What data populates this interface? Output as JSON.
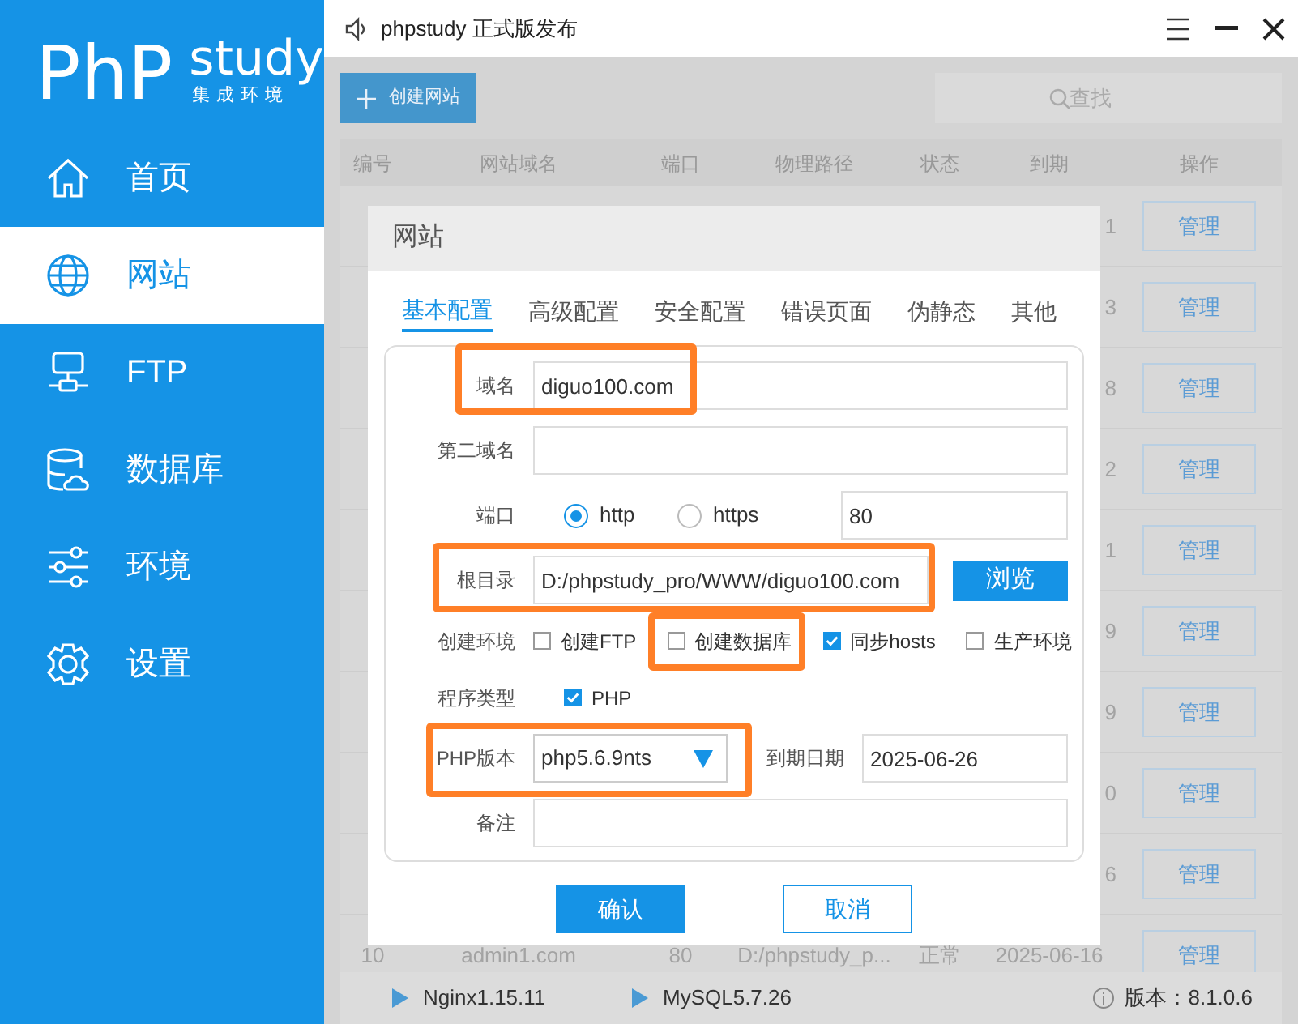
{
  "window": {
    "title": "phpstudy 正式版发布"
  },
  "sidebar": {
    "logo": {
      "main": "PhP",
      "sub": "study",
      "tagline": "集成环境"
    },
    "items": [
      {
        "label": "首页",
        "selected": false
      },
      {
        "label": "网站",
        "selected": true
      },
      {
        "label": "FTP",
        "selected": false
      },
      {
        "label": "数据库",
        "selected": false
      },
      {
        "label": "环境",
        "selected": false
      },
      {
        "label": "设置",
        "selected": false
      }
    ]
  },
  "toolbar": {
    "create_button": "创建网站",
    "search": {
      "placeholder": "查找"
    }
  },
  "table": {
    "columns": [
      "编号",
      "网站域名",
      "端口",
      "物理路径",
      "状态",
      "到期",
      "操作"
    ],
    "rows": [
      {
        "expiry": "1",
        "action": "管理"
      },
      {
        "expiry": "3",
        "action": "管理"
      },
      {
        "expiry": "8",
        "action": "管理"
      },
      {
        "expiry": "2",
        "action": "管理"
      },
      {
        "expiry": "1",
        "action": "管理"
      },
      {
        "expiry": "9",
        "action": "管理"
      },
      {
        "expiry": "9",
        "action": "管理"
      },
      {
        "expiry": "0",
        "action": "管理"
      },
      {
        "expiry": "6",
        "action": "管理"
      },
      {
        "number": "10",
        "domain": "admin1.com",
        "port": "80",
        "path": "D:/phpstudy_p...",
        "status": "正常",
        "expiry": "2025-06-16",
        "action": "管理"
      }
    ]
  },
  "dialog": {
    "title": "网站",
    "tabs": [
      {
        "label": "基本配置",
        "selected": true
      },
      {
        "label": "高级配置",
        "selected": false
      },
      {
        "label": "安全配置",
        "selected": false
      },
      {
        "label": "错误页面",
        "selected": false
      },
      {
        "label": "伪静态",
        "selected": false
      },
      {
        "label": "其他",
        "selected": false
      }
    ],
    "fields": [
      {
        "kind": "text",
        "label": "域名",
        "value": "diguo100.com",
        "highlighted": true
      },
      {
        "kind": "text",
        "label": "第二域名",
        "highlighted": false
      },
      {
        "kind": "port",
        "label": "端口",
        "options": [
          {
            "label": "http",
            "selected": true
          },
          {
            "label": "https",
            "selected": false
          }
        ],
        "value": "80"
      },
      {
        "kind": "path",
        "label": "根目录",
        "value": "D:/phpstudy_pro/WWW/diguo100.com",
        "button": "浏览",
        "highlighted": true
      },
      {
        "kind": "checks",
        "label": "创建环境",
        "options": [
          {
            "label": "创建FTP",
            "checked": false,
            "highlighted": false
          },
          {
            "label": "创建数据库",
            "checked": false,
            "highlighted": true
          },
          {
            "label": "同步hosts",
            "checked": true,
            "highlighted": false
          },
          {
            "label": "生产环境",
            "checked": false,
            "highlighted": false
          }
        ]
      },
      {
        "kind": "checks",
        "label": "程序类型",
        "options": [
          {
            "label": "PHP",
            "checked": true,
            "highlighted": false
          }
        ]
      },
      {
        "kind": "select_date",
        "label": "PHP版本",
        "value": "php5.6.9nts",
        "highlighted": true,
        "date_label": "到期日期",
        "date_value": "2025-06-26"
      },
      {
        "kind": "text",
        "label": "备注",
        "highlighted": false
      }
    ],
    "buttons": [
      {
        "label": "确认",
        "primary": true
      },
      {
        "label": "取消",
        "primary": false
      }
    ]
  },
  "status_bar": {
    "services": [
      {
        "name": "Nginx1.15.11"
      },
      {
        "name": "MySQL5.7.26"
      }
    ],
    "version": "版本：8.1.0.6"
  }
}
